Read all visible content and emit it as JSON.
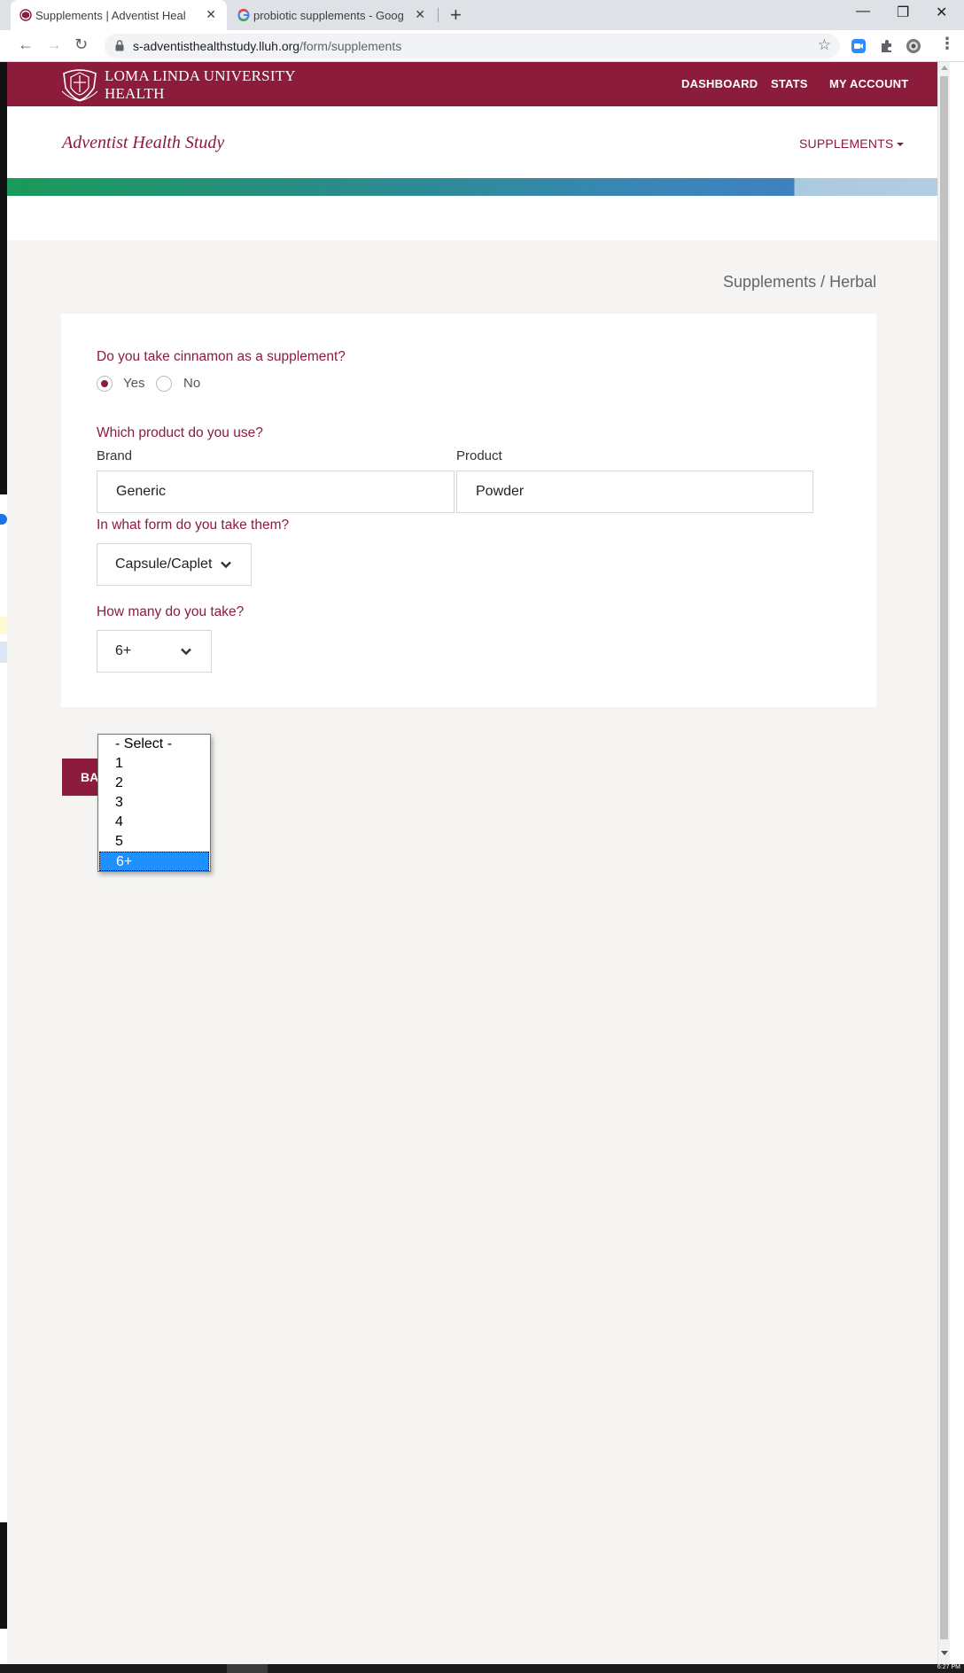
{
  "browser": {
    "tabs": [
      {
        "title": "Supplements | Adventist Health Study",
        "active": true
      },
      {
        "title": "probiotic supplements - Google Search",
        "active": false
      }
    ],
    "url_host": "s-adventisthealthstudy.lluh.org",
    "url_path": "/form/supplements",
    "new_tab_label": "+",
    "close_glyph": "✕",
    "min_glyph": "—",
    "max_glyph": "❐",
    "win_close_glyph": "✕"
  },
  "header": {
    "logo_line1": "LOMA LINDA UNIVERSITY",
    "logo_line2": "HEALTH",
    "nav": [
      "DASHBOARD",
      "STATS",
      "MY ACCOUNT"
    ],
    "site_title": "Adventist Health Study",
    "supplements_menu": "SUPPLEMENTS",
    "brand_color": "#8c1c3c"
  },
  "page": {
    "breadcrumb": "Supplements / Herbal"
  },
  "form": {
    "q1": "Do you take cinnamon as a supplement?",
    "q1_options": [
      "Yes",
      "No"
    ],
    "q1_selected": "Yes",
    "q2": "Which product do you use?",
    "brand_label": "Brand",
    "brand_value": "Generic",
    "product_label": "Product",
    "product_value": "Powder",
    "q3": "In what form do you take them?",
    "form_value": "Capsule/Caplet",
    "q4": "How many do you take?",
    "count_value": "6+",
    "count_options": [
      "- Select -",
      "1",
      "2",
      "3",
      "4",
      "5",
      "6+"
    ],
    "back_button": "BA"
  },
  "taskbar": {
    "clock": "6:27 PM"
  }
}
